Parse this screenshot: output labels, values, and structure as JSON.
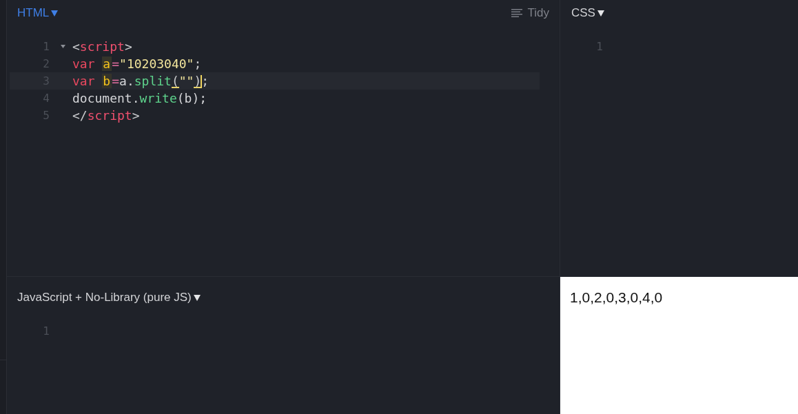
{
  "html_panel": {
    "language": "HTML",
    "active": true,
    "tidy": "Tidy",
    "lines": [
      {
        "number": "1",
        "foldable": true,
        "active": false,
        "caret": false,
        "tokens": [
          {
            "text": "<",
            "kind": "punct"
          },
          {
            "text": "script",
            "kind": "tag"
          },
          {
            "text": ">",
            "kind": "punct"
          }
        ]
      },
      {
        "number": "2",
        "foldable": false,
        "active": false,
        "caret": false,
        "tokens": [
          {
            "text": "var ",
            "kind": "keyword"
          },
          {
            "text": "a",
            "kind": "def"
          },
          {
            "text": "=",
            "kind": "operator"
          },
          {
            "text": "\"10203040\"",
            "kind": "string"
          },
          {
            "text": ";",
            "kind": "punct"
          }
        ]
      },
      {
        "number": "3",
        "foldable": false,
        "active": true,
        "caret": true,
        "tokens": [
          {
            "text": "var ",
            "kind": "keyword"
          },
          {
            "text": "b",
            "kind": "def"
          },
          {
            "text": "=",
            "kind": "operator"
          },
          {
            "text": "a.",
            "kind": "plain"
          },
          {
            "text": "split",
            "kind": "property"
          },
          {
            "text": "(",
            "kind": "match"
          },
          {
            "text": "\"\"",
            "kind": "string"
          },
          {
            "text": ")",
            "kind": "match"
          },
          {
            "text": ";",
            "kind": "punct"
          }
        ]
      },
      {
        "number": "4",
        "foldable": false,
        "active": false,
        "caret": false,
        "tokens": [
          {
            "text": "document.",
            "kind": "plain"
          },
          {
            "text": "write",
            "kind": "property"
          },
          {
            "text": "(b);",
            "kind": "plain"
          }
        ]
      },
      {
        "number": "5",
        "foldable": false,
        "active": false,
        "caret": false,
        "tokens": [
          {
            "text": "</",
            "kind": "punct"
          },
          {
            "text": "script",
            "kind": "tag"
          },
          {
            "text": ">",
            "kind": "punct"
          }
        ]
      }
    ]
  },
  "css_panel": {
    "language": "CSS",
    "active": false,
    "lines": [
      {
        "number": "1",
        "foldable": false,
        "active": false
      }
    ]
  },
  "js_panel": {
    "language": "JavaScript + No-Library (pure JS)",
    "active": false,
    "lines": [
      {
        "number": "1",
        "foldable": false,
        "active": false
      }
    ]
  },
  "result_panel": {
    "output": "1,0,2,0,3,0,4,0"
  }
}
